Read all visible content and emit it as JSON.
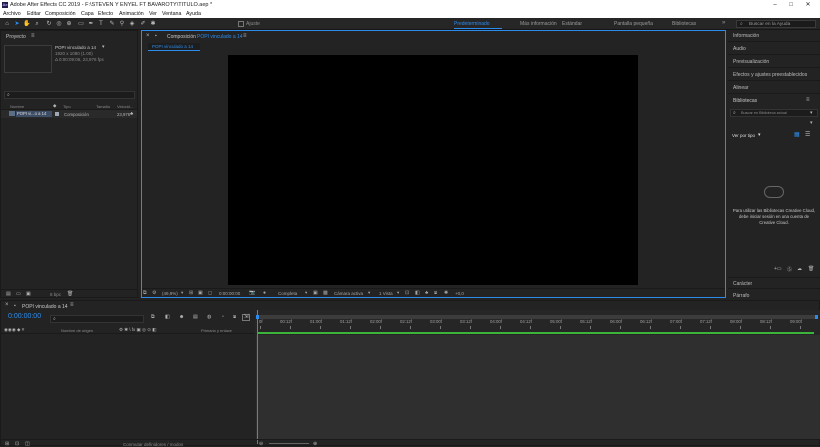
{
  "window": {
    "title": "Adobe After Effects CC 2019 - F:\\STEVEN Y ENYEL FT BAVAROTY\\TITULO.aep *",
    "icon": "after-effects-logo",
    "minimize": "–",
    "maximize": "□",
    "close": "✕"
  },
  "menu": [
    "Archivo",
    "Editar",
    "Composición",
    "Capa",
    "Efecto",
    "Animación",
    "Ver",
    "Ventana",
    "Ayuda"
  ],
  "toolbar": {
    "ajuste_label": "Ajuste",
    "workspaces": [
      "Predeterminado",
      "Más información",
      "Estándar",
      "Pantalla pequeña",
      "Bibliotecas"
    ],
    "active_workspace": "Predeterminado",
    "overflow": "»",
    "search_placeholder": "Buscar en la Ayuda"
  },
  "project": {
    "title": "Proyecto",
    "item_name": "POPI vinculado a 14",
    "item_resolution": "1920 x 1080 (1.00)",
    "item_duration": "Δ 0:00:09:06, 23,976 fps",
    "search_placeholder": "",
    "columns": [
      "Nombre",
      "Tipo",
      "Tamaño",
      "Velocid..."
    ],
    "rows": [
      {
        "name": "POPI vi...o a 14",
        "type": "Composición",
        "fps": "23,976"
      }
    ],
    "bpc_label": "8 bpc"
  },
  "composition": {
    "title": "Composición",
    "comp_name": "POPI vinculado a 14",
    "tab_label": "POPI vinculado a 14",
    "zoom": "(49,9%)",
    "timecode": "0:00:00:00",
    "resolution": "Completa",
    "camera": "Cámara activa",
    "views": "1 Vista",
    "exposure": "+0,0"
  },
  "right_panels": {
    "items": [
      "Información",
      "Audio",
      "Previsualización",
      "Efectos y ajustes preestablecidos",
      "Alinear"
    ],
    "libraries_title": "Bibliotecas",
    "libraries_search_placeholder": "Buscar en Biblioteca actual",
    "view_by_type": "Ver por tipo",
    "cc_message": "Para utilizar las Bibliotecas Creative Cloud, debe iniciar sesión en una cuenta de Creative Cloud.",
    "bottom_items": [
      "Carácter",
      "Párrafo"
    ]
  },
  "timeline": {
    "tab": "POPI vinculado a 14",
    "timecode": "0:00:00:00",
    "search_placeholder": "",
    "col_name": "Nombre de origen",
    "col_parent": "Primario y enlace",
    "footer_label": "Conmutar definidores / modos",
    "ruler": [
      "0f",
      "00:12f",
      "01:00f",
      "01:12f",
      "02:00f",
      "02:12f",
      "03:00f",
      "03:12f",
      "04:00f",
      "04:12f",
      "05:00f",
      "05:12f",
      "06:00f",
      "06:12f",
      "07:00f",
      "07:12f",
      "08:00f",
      "08:12f",
      "09:00f"
    ]
  }
}
